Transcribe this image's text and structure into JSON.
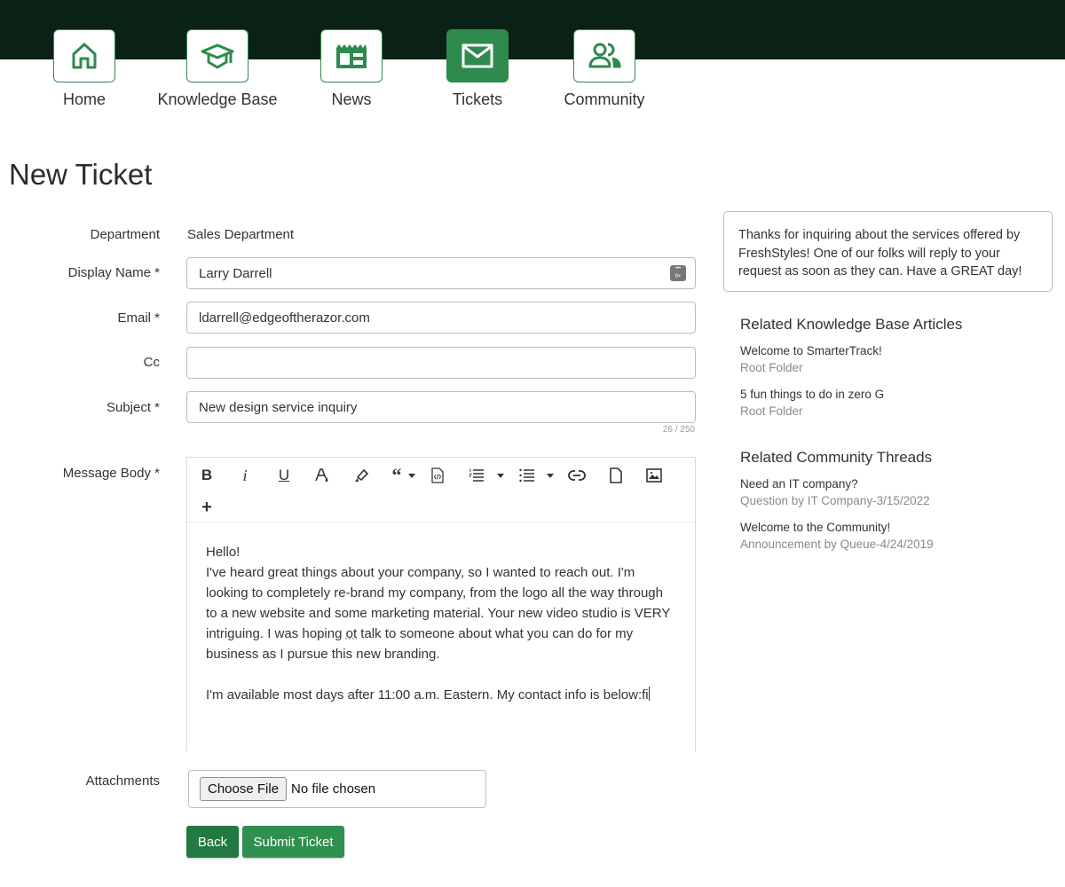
{
  "colors": {
    "header_bg": "#0a2215",
    "accent": "#2f8a4e",
    "back_button": "#237a40",
    "submit_button": "#2f8f4f"
  },
  "nav": {
    "items": [
      {
        "label": "Home",
        "icon": "home-icon",
        "active": false
      },
      {
        "label": "Knowledge Base",
        "icon": "graduation-cap-icon",
        "active": false
      },
      {
        "label": "News",
        "icon": "newspaper-icon",
        "active": false
      },
      {
        "label": "Tickets",
        "icon": "envelope-icon",
        "active": true
      },
      {
        "label": "Community",
        "icon": "users-icon",
        "active": false
      }
    ]
  },
  "page": {
    "title": "New Ticket"
  },
  "form": {
    "department": {
      "label": "Department",
      "value": "Sales Department"
    },
    "display_name": {
      "label": "Display Name *",
      "value": "Larry Darrell"
    },
    "email": {
      "label": "Email *",
      "value": "ldarrell@edgeoftherazor.com"
    },
    "cc": {
      "label": "Cc",
      "value": ""
    },
    "subject": {
      "label": "Subject *",
      "value": "New design service inquiry",
      "counter": "26 / 250"
    },
    "message": {
      "label": "Message Body *",
      "toolbar": [
        "bold",
        "italic",
        "underline",
        "text-color",
        "highlight",
        "blockquote",
        "code-view",
        "ordered-list",
        "unordered-list",
        "link",
        "file",
        "image",
        "more"
      ],
      "line1": "Hello!",
      "para1_a": "I've heard great things about your company, so I wanted to reach out. I'm looking to completely re-brand my company, from the logo all the way through to a new website and some marketing material. Your new video studio is VERY intriguing. I was hoping ",
      "para1_typo": "ot",
      "para1_b": " talk to someone about what you can do for my business as I pursue this new branding.",
      "para2": "I'm available most days after 11:00 a.m. Eastern. My contact info is below:fi"
    },
    "attachments": {
      "label": "Attachments",
      "button": "Choose File",
      "status": "No file chosen"
    },
    "buttons": {
      "back": "Back",
      "submit": "Submit Ticket"
    }
  },
  "sidebar": {
    "info": "Thanks for inquiring about the services offered by FreshStyles! One of our folks will reply to your request as soon as they can. Have a GREAT day!",
    "kb": {
      "heading": "Related Knowledge Base Articles",
      "items": [
        {
          "title": "Welcome to SmarterTrack!",
          "folder": "Root Folder"
        },
        {
          "title": "5 fun things to do in zero G",
          "folder": "Root Folder"
        }
      ]
    },
    "community": {
      "heading": "Related Community Threads",
      "items": [
        {
          "title": "Need an IT company?",
          "meta": "Question by IT Company-3/15/2022"
        },
        {
          "title": "Welcome to the Community!",
          "meta": "Announcement by Queue-4/24/2019"
        }
      ]
    }
  }
}
